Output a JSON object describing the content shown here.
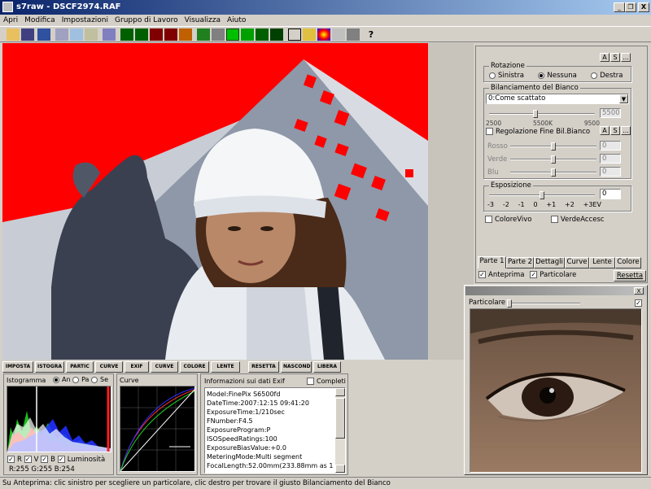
{
  "window": {
    "title": "s7raw - DSCF2974.RAF",
    "min": "_",
    "max": "❐",
    "close": "X"
  },
  "menu": [
    "Apri",
    "Modifica",
    "Impostazioni",
    "Gruppo di Lavoro",
    "Visualizza",
    "Aiuto"
  ],
  "bottom_tabs": [
    "IMPOSTA",
    "ISTOGRA",
    "PARTIC",
    "CURVE",
    "EXIF",
    "CURVE",
    "COLORE",
    "LENTE",
    "RESETTA",
    "NASCOND",
    "LIBERA"
  ],
  "histogram": {
    "title": "Istogramma",
    "modes": [
      "An",
      "Pa",
      "Se"
    ],
    "channels": [
      "R",
      "V",
      "B",
      "Luminosità"
    ],
    "readout": "R:255 G:255 B:254"
  },
  "curve": {
    "title": "Curve"
  },
  "exif": {
    "title": "Informazioni sui dati Exif",
    "complete_label": "Completi",
    "lines": [
      "Model:FinePix S6500fd",
      "DateTime:2007:12:15 09:41:20",
      "ExposureTime:1/210sec",
      "FNumber:F4.5",
      "ExposureProgram:P",
      "ISOSpeedRatings:100",
      "ExposureBiasValue:+0.0",
      "MeteringMode:Multi segment",
      "FocalLength:52.00mm(233.88mm as 135)"
    ]
  },
  "right_panel": {
    "as_buttons": [
      "A",
      "S",
      "..."
    ],
    "rotation": {
      "label": "Rotazione",
      "options": [
        "Sinistra",
        "Nessuna",
        "Destra"
      ],
      "selected": "Nessuna"
    },
    "wb": {
      "label": "Bilanciamento del Bianco",
      "value": "0:Come scattato",
      "temp_value": "5500",
      "scale": [
        "2500",
        "5500K",
        "9500"
      ],
      "fine_label": "Regolazione Fine Bil.Bianco",
      "channels": [
        {
          "label": "Rosso",
          "value": "0"
        },
        {
          "label": "Verde",
          "value": "0"
        },
        {
          "label": "Blu",
          "value": "0"
        }
      ]
    },
    "exposure": {
      "label": "Esposizione",
      "value": "0",
      "scale": [
        "-3",
        "-2",
        "-1",
        "0",
        "+1",
        "+2",
        "+3EV"
      ]
    },
    "checks": [
      "ColoreVivo",
      "VerdeAccesc"
    ],
    "tabs": [
      "Parte 1",
      "Parte 2",
      "Dettagli",
      "Curve",
      "Lente",
      "Colore"
    ],
    "preview_label": "Anteprima",
    "particolare_label": "Particolare",
    "reset_label": "Resetta"
  },
  "detail_window": {
    "label": "Particolare",
    "close": "X"
  },
  "status": "Su Anteprima: clic sinistro per scegliere un particolare, clic destro per trovare il giusto Bilanciamento del Bianco"
}
